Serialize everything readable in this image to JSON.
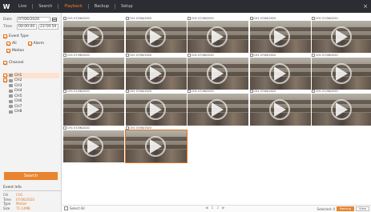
{
  "app": {
    "logo": "W",
    "menu": [
      "Live",
      "Search",
      "Playback",
      "Backup",
      "Setup"
    ],
    "active_menu_index": 2,
    "close_label": "×"
  },
  "sidebar": {
    "date_label": "Date",
    "date_value": "07/06/2020",
    "time_label": "Time",
    "time_from": "00:00:00",
    "time_to": "23:59:59",
    "event_title": "Event Type",
    "event_all": "All",
    "event_alarm": "Alarm",
    "event_motion": "Motion",
    "channel_title": "Channel",
    "channels": [
      {
        "label": "CH1",
        "selected": true
      },
      {
        "label": "CH2",
        "selected": true
      },
      {
        "label": "CH3",
        "selected": false
      },
      {
        "label": "CH4",
        "selected": false
      },
      {
        "label": "CH5",
        "selected": false
      },
      {
        "label": "CH6",
        "selected": false
      },
      {
        "label": "CH7",
        "selected": false
      },
      {
        "label": "CH8",
        "selected": false
      }
    ],
    "search_button": "Search",
    "info": {
      "title": "Event Info",
      "rows": [
        {
          "k": "CH",
          "v": "CH1"
        },
        {
          "k": "Time",
          "v": "07/06/2020"
        },
        {
          "k": "Type",
          "v": "Motion"
        },
        {
          "k": "Size",
          "v": "71.14MB"
        }
      ]
    }
  },
  "grid": {
    "items": [
      {
        "caption": "CH1 07/06/2020"
      },
      {
        "caption": "CH1 07/06/2020"
      },
      {
        "caption": "CH1 07/06/2020"
      },
      {
        "caption": "CH1 07/06/2020"
      },
      {
        "caption": "CH1 07/06/2020"
      },
      {
        "caption": "CH1 07/06/2020"
      },
      {
        "caption": "CH1 07/06/2020"
      },
      {
        "caption": "CH1 07/06/2020"
      },
      {
        "caption": "CH1 07/06/2020"
      },
      {
        "caption": "CH1 07/06/2020"
      },
      {
        "caption": "CH1 07/06/2020"
      },
      {
        "caption": "CH1 07/06/2020"
      },
      {
        "caption": "CH1 07/06/2020"
      },
      {
        "caption": "CH1 07/06/2020"
      },
      {
        "caption": "CH1 07/06/2020"
      },
      {
        "caption": "CH1 07/06/2020"
      },
      {
        "caption": "CH1 07/06/2020"
      }
    ]
  },
  "footer": {
    "select_all": "Select All",
    "pages": [
      "◀",
      "1",
      "2",
      "▶"
    ],
    "right_label": "Selected: 0",
    "btn_backup": "Backup",
    "btn_view": "View"
  }
}
